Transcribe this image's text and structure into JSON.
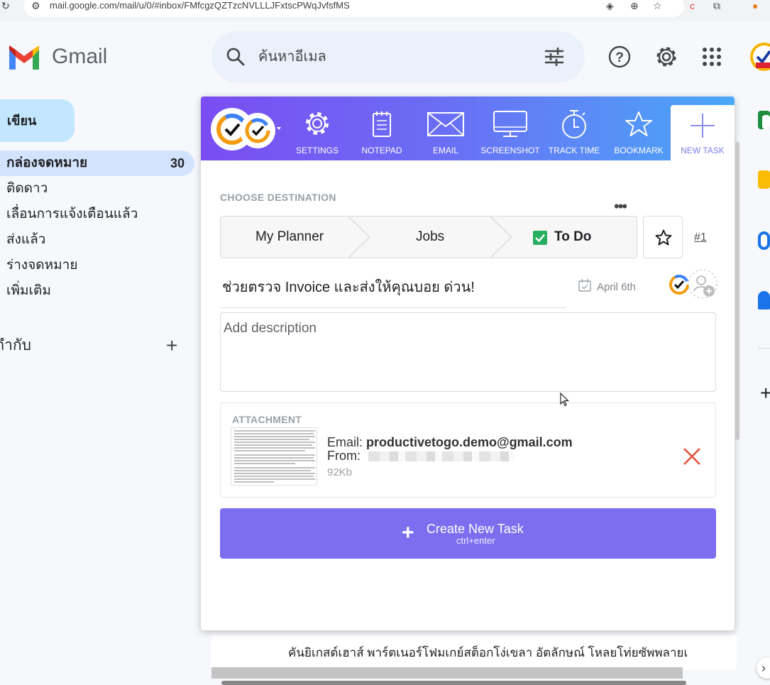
{
  "browser": {
    "url": "mail.google.com/mail/u/0/#inbox/FMfcgzQZTzcNVLLLJFxtscPWqJvfsfMS"
  },
  "gmail": {
    "product_name": "Gmail",
    "search_placeholder": "ค้นหาอีเมล",
    "compose_label": "เขียน",
    "nav": {
      "inbox_label": "กล่องจดหมาย",
      "inbox_count": "30",
      "starred_label": "ติดดาว",
      "snoozed_label": "เลื่อนการแจ้งเตือนแล้ว",
      "sent_label": "ส่งแล้ว",
      "drafts_label": "ร่างจดหมาย",
      "more_label": "เพิ่มเติม"
    },
    "labels_title": "ป้ายกำกับ",
    "labels_add": "+",
    "bottom_row_text": "คันยิเกสต์เฮาส์ พาร์ตเนอร์โฟมเกย์สต็อกโง่เขลา อัตลักษณ์ โหลยโท่ยซัพพลายเ"
  },
  "popup": {
    "toolbar": {
      "settings_label": "SETTINGS",
      "notepad_label": "NOTEPAD",
      "email_label": "EMAIL",
      "screenshot_label": "SCREENSHOT",
      "track_time_label": "TRACK TIME",
      "bookmark_label": "BOOKMARK",
      "new_task_label": "NEW TASK"
    },
    "destination_title": "CHOOSE DESTINATION",
    "more_label": "•••",
    "breadcrumbs": {
      "planner": "My Planner",
      "bucket": "Jobs",
      "list": "To Do"
    },
    "priority_label": "#1",
    "task_title": "ช่วยตรวจ Invoice และส่งให้คุณบอย ด่วน!",
    "due_date": "April 6th",
    "description_placeholder": "Add description",
    "attachment": {
      "title": "ATTACHMENT",
      "email_prefix": "Email: ",
      "email_value": "productivetogo.demo@gmail.com",
      "from_label": "From:",
      "size": "92Kb"
    },
    "create_button": {
      "label": "Create New Task",
      "hint": "ctrl+enter",
      "icon": "+"
    },
    "accent_color": "#7b6ff0",
    "remove_color": "#e0533b"
  }
}
